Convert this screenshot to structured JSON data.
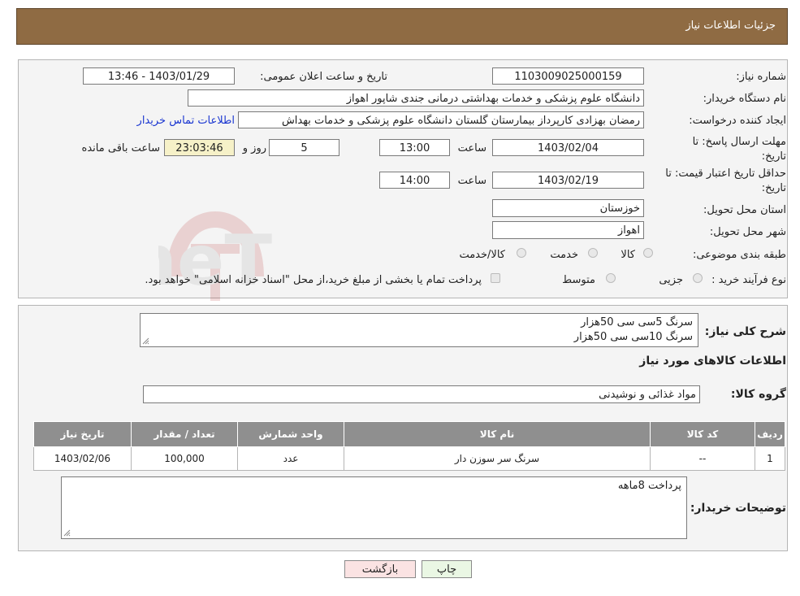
{
  "header": {
    "title": "جزئیات اطلاعات نیاز"
  },
  "form": {
    "need_number_label": "شماره نیاز:",
    "need_number": "1103009025000159",
    "announce_label": "تاریخ و ساعت اعلان عمومی:",
    "announce_value": "1403/01/29 - 13:46",
    "buyer_org_label": "نام دستگاه خریدار:",
    "buyer_org": "دانشگاه علوم پزشکی و خدمات بهداشتی درمانی جندی شاپور اهواز",
    "creator_label": "ایجاد کننده درخواست:",
    "creator": "رمضان بهزادی کارپرداز بیمارستان گلستان دانشگاه علوم پزشکی و خدمات بهداش",
    "contact_link": "اطلاعات تماس خریدار",
    "deadline_label_1": "مهلت ارسال پاسخ: تا",
    "deadline_label_2": "تاریخ:",
    "deadline_date": "1403/02/04",
    "time_label": "ساعت",
    "deadline_time": "13:00",
    "days_value": "5",
    "days_label": "روز و",
    "remaining_time": "23:03:46",
    "remaining_label": "ساعت باقی مانده",
    "validity_label_1": "حداقل تاریخ اعتبار قیمت: تا",
    "validity_label_2": "تاریخ:",
    "validity_date": "1403/02/19",
    "validity_time": "14:00",
    "province_label": "استان محل تحویل:",
    "province": "خوزستان",
    "city_label": "شهر محل تحویل:",
    "city": "اهواز",
    "category_label": "طبقه بندی موضوعی:",
    "category_options": [
      "کالا",
      "خدمت",
      "کالا/خدمت"
    ],
    "purchase_type_label": "نوع فرآیند خرید :",
    "purchase_options": [
      "جزیی",
      "متوسط"
    ],
    "purchase_note": "پرداخت تمام یا بخشی از مبلغ خرید،از محل \"اسناد خزانه اسلامی\" خواهد بود."
  },
  "watermark": {
    "text": "AriaTender.neT"
  },
  "details": {
    "summary_label": "شرح کلی نیاز:",
    "summary_lines": [
      "سرنگ 5سی سی 50هزار",
      "سرنگ 10سی سی 50هزار"
    ],
    "goods_info_title": "اطلاعات کالاهای مورد نیاز",
    "goods_group_label": "گروه کالا:",
    "goods_group": "مواد غذائی و نوشیدنی",
    "table_headers": [
      "ردیف",
      "کد کالا",
      "نام کالا",
      "واحد شمارش",
      "تعداد / مقدار",
      "تاریخ نیاز"
    ],
    "table_rows": [
      [
        "1",
        "--",
        "سرنگ سر سوزن دار",
        "عدد",
        "100,000",
        "1403/02/06"
      ]
    ],
    "buyer_notes_label": "توضیحات خریدار:",
    "buyer_notes": "پرداخت 8ماهه"
  },
  "buttons": {
    "print": "چاپ",
    "back": "بازگشت"
  },
  "colors": {
    "header_bg": "#8f6b43",
    "table_header_bg": "#8f8f8f",
    "link": "#1a36d1",
    "highlight": "#f6f1c8",
    "back_button_bg": "#fbe3e3",
    "print_button_bg": "#eaf7e4"
  }
}
